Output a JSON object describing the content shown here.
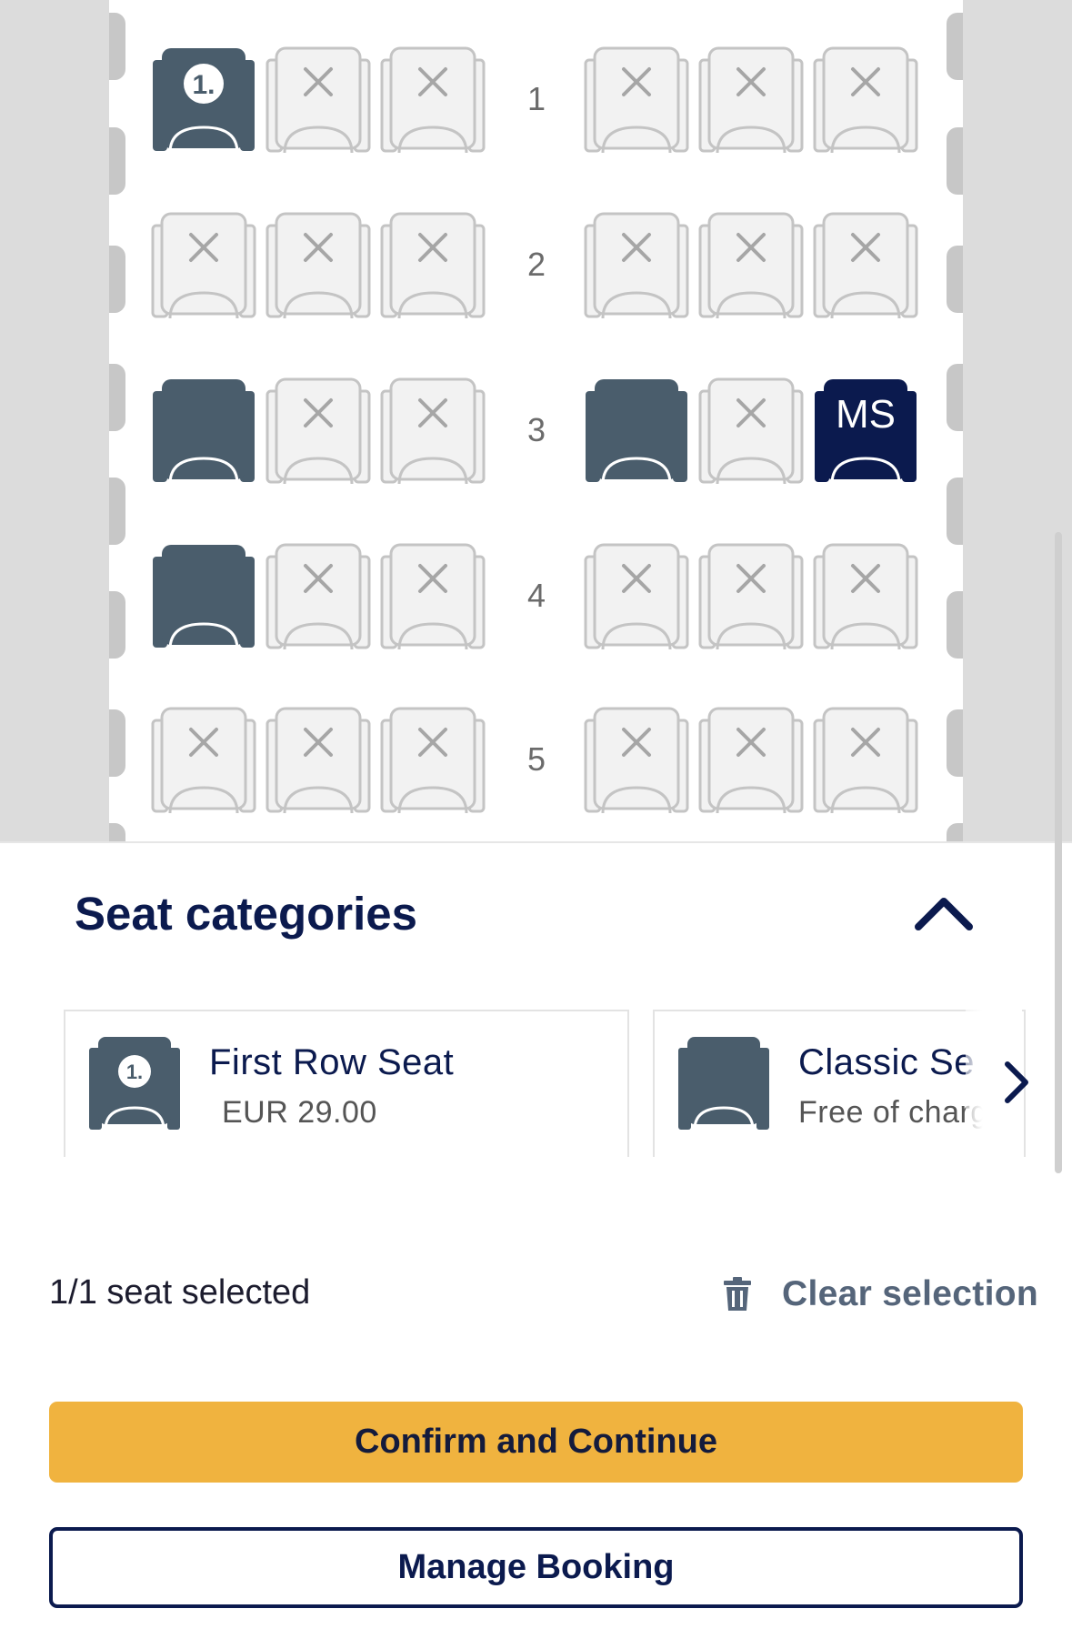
{
  "seat_map": {
    "rows": [
      {
        "number": "1",
        "seats": [
          "first-row",
          "occupied",
          "occupied",
          "occupied",
          "occupied",
          "occupied"
        ]
      },
      {
        "number": "2",
        "seats": [
          "occupied",
          "occupied",
          "occupied",
          "occupied",
          "occupied",
          "occupied"
        ]
      },
      {
        "number": "3",
        "seats": [
          "available",
          "occupied",
          "occupied",
          "available",
          "occupied",
          "selected"
        ]
      },
      {
        "number": "4",
        "seats": [
          "available",
          "occupied",
          "occupied",
          "occupied",
          "occupied",
          "occupied"
        ]
      },
      {
        "number": "5",
        "seats": [
          "occupied",
          "occupied",
          "occupied",
          "occupied",
          "occupied",
          "occupied"
        ]
      }
    ],
    "first_row_badge": "1.",
    "selected_seat_label": "MS",
    "colors": {
      "available": "#4a5d6c",
      "selected": "#0b1a4e",
      "occupied_fill": "#f2f2f2",
      "occupied_stroke": "#c4c4c4",
      "cabin_bg": "#ffffff",
      "fuselage": "#dcdcdc"
    }
  },
  "categories": {
    "title": "Seat categories",
    "collapse_icon": "chevron-up-icon",
    "items": [
      {
        "name": "First Row Seat",
        "price": "EUR  29.00",
        "icon": "first-row-seat-icon"
      },
      {
        "name": "Classic Se",
        "price": "Free of charg",
        "icon": "classic-seat-icon"
      }
    ],
    "next_icon": "chevron-right-icon"
  },
  "selection": {
    "count_text": "1/1 seat selected",
    "clear_label": "Clear selection",
    "clear_icon": "trash-icon"
  },
  "buttons": {
    "confirm_label": "Confirm and Continue",
    "manage_label": "Manage Booking",
    "confirm_color": "#f0b33f",
    "brand_color": "#0b1a4e"
  }
}
